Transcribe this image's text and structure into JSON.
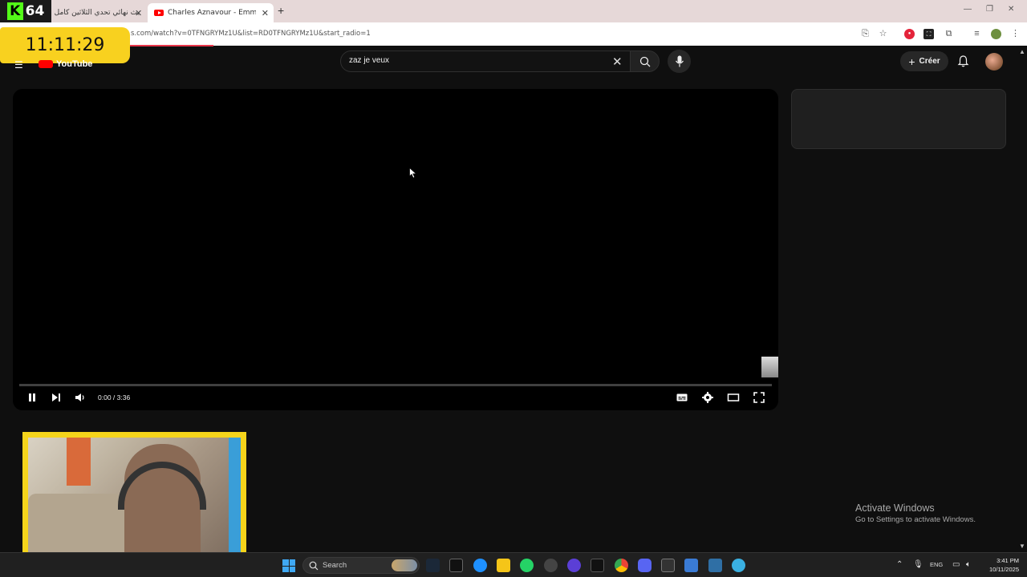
{
  "browser": {
    "tabs": [
      {
        "label": "بث نهائي تحدي الثلاثين كامل",
        "active": false
      },
      {
        "label": "Charles Aznavour - Emmenez-moi",
        "active": true
      }
    ],
    "url": "s.com/watch?v=0TFNGRYMz1U&list=RD0TFNGRYMz1U&start_radio=1"
  },
  "overlay": {
    "kick_number": "64",
    "clock": "11:11:29"
  },
  "youtube": {
    "logo_text": "YouTube",
    "search_value": "zaz je veux",
    "create_label": "Créer"
  },
  "player": {
    "time": "0:00 / 3:36",
    "progress": 0.0
  },
  "watermark": {
    "title": "Activate Windows",
    "subtitle": "Go to Settings to activate Windows."
  },
  "taskbar": {
    "search_label": "Search",
    "lang": "ENG",
    "time": "3:41 PM",
    "date": "10/11/2025"
  },
  "colors": {
    "accent_overlay": "#f8d11f",
    "kick_green": "#53fc18",
    "yt_red": "#ff0000"
  }
}
